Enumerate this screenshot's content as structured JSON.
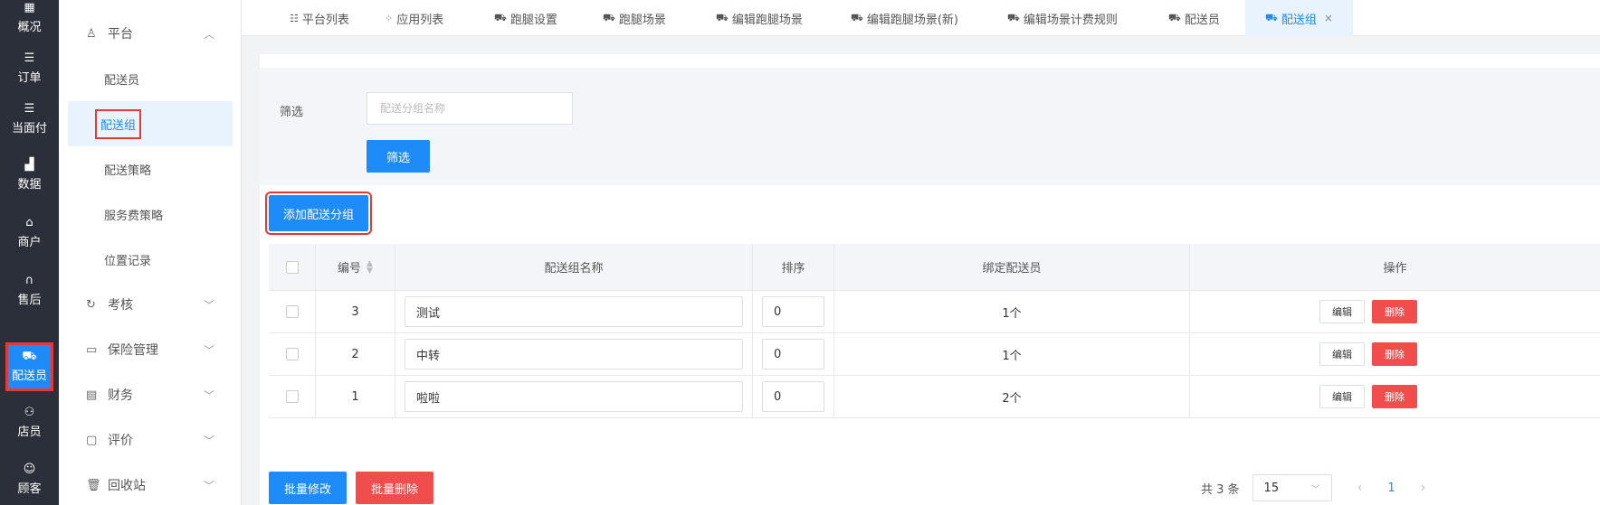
{
  "leftnav": {
    "items": [
      {
        "label": "概况",
        "icon": "grid-icon"
      },
      {
        "label": "订单",
        "icon": "list-icon"
      },
      {
        "label": "当面付",
        "icon": "list-icon"
      },
      {
        "label": "数据",
        "icon": "bar-chart-icon"
      },
      {
        "label": "商户",
        "icon": "store-icon"
      },
      {
        "label": "售后",
        "icon": "headset-icon"
      },
      {
        "label": "配送员",
        "icon": "scooter-icon"
      },
      {
        "label": "店员",
        "icon": "users-icon"
      },
      {
        "label": "顾客",
        "icon": "smile-icon"
      }
    ],
    "active_index": 6
  },
  "subsidebar": {
    "section_platform": "平台",
    "items": [
      "配送员",
      "配送组",
      "配送策略",
      "服务费策略",
      "位置记录"
    ],
    "active_item": "配送组",
    "sections": [
      "考核",
      "保险管理",
      "财务",
      "评价",
      "回收站"
    ]
  },
  "tabs": [
    {
      "label": "平台列表",
      "icon": "sliders-icon"
    },
    {
      "label": "应用列表",
      "icon": "apps-icon"
    },
    {
      "label": "跑腿设置",
      "icon": "scooter-icon"
    },
    {
      "label": "跑腿场景",
      "icon": "scooter-icon"
    },
    {
      "label": "编辑跑腿场景",
      "icon": "scooter-icon"
    },
    {
      "label": "编辑跑腿场景(新)",
      "icon": "scooter-icon"
    },
    {
      "label": "编辑场景计费规则",
      "icon": "scooter-icon"
    },
    {
      "label": "配送员",
      "icon": "scooter-icon"
    },
    {
      "label": "配送组",
      "icon": "scooter-icon",
      "active": true
    }
  ],
  "filter": {
    "label": "筛选",
    "placeholder": "配送分组名称",
    "button": "筛选"
  },
  "add_button": "添加配送分组",
  "table": {
    "headers": {
      "id": "编号",
      "name": "配送组名称",
      "sort": "排序",
      "bind": "绑定配送员",
      "op": "操作"
    },
    "rows": [
      {
        "id": "3",
        "name": "测试",
        "sort": "0",
        "bind": "1个"
      },
      {
        "id": "2",
        "name": "中转",
        "sort": "0",
        "bind": "1个"
      },
      {
        "id": "1",
        "name": "啦啦",
        "sort": "0",
        "bind": "2个"
      }
    ],
    "edit_label": "编辑",
    "delete_label": "删除"
  },
  "bulk": {
    "edit": "批量修改",
    "delete": "批量删除"
  },
  "pager": {
    "total": "共 3 条",
    "page_size": "15",
    "current_page": "1"
  },
  "colors": {
    "accent": "#1d8cf8",
    "danger": "#f24d4d",
    "nav_bg": "#2b2f3a",
    "highlight_border": "#e53935"
  }
}
